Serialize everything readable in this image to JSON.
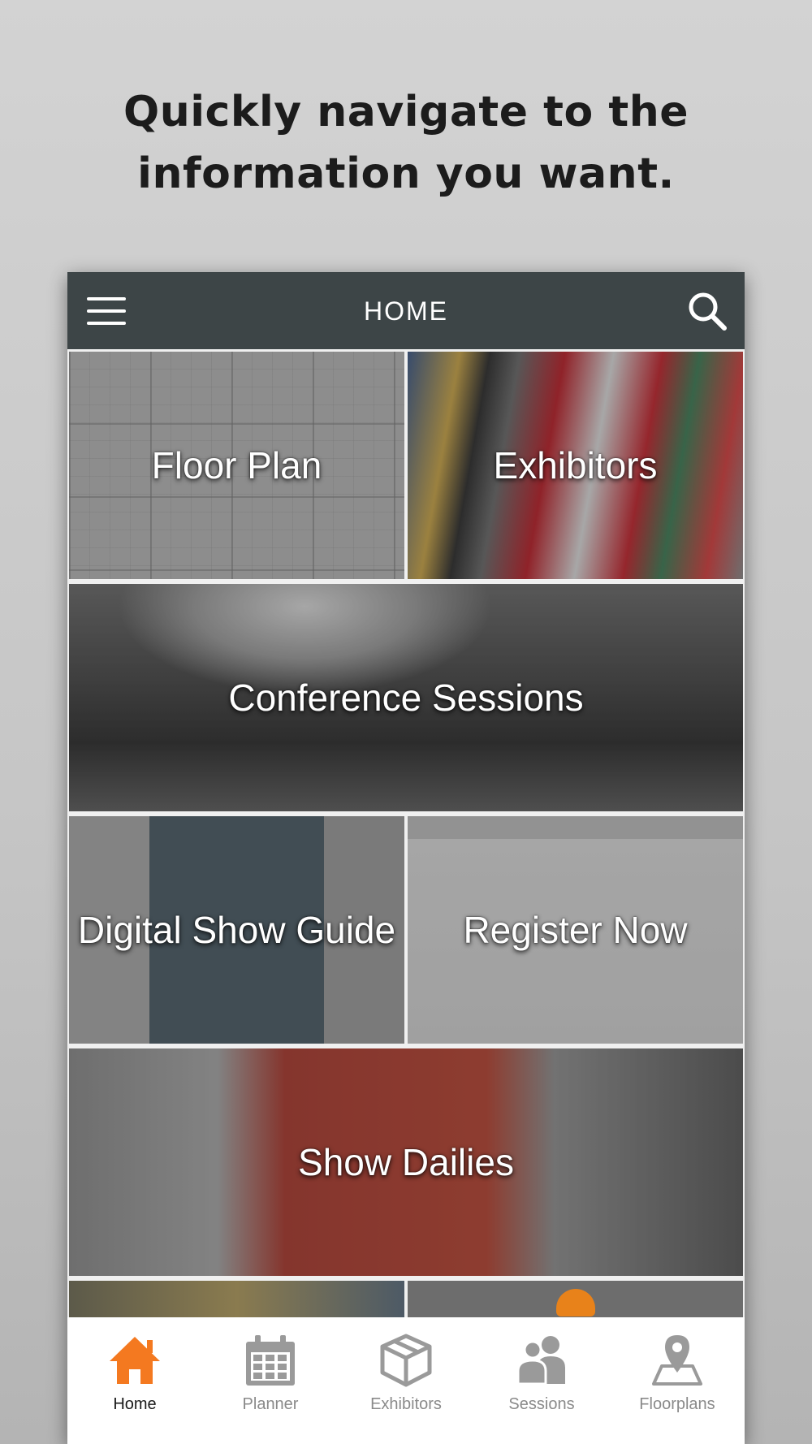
{
  "headline": {
    "line1": "Quickly navigate to the",
    "line2": "information you want."
  },
  "appbar": {
    "title": "HOME",
    "menu_icon": "hamburger-menu-icon",
    "search_icon": "search-icon"
  },
  "tiles": [
    {
      "label": "Floor Plan"
    },
    {
      "label": "Exhibitors"
    },
    {
      "label": "Conference Sessions"
    },
    {
      "label": "Digital Show Guide"
    },
    {
      "label": "Register Now"
    },
    {
      "label": "Show Dailies"
    }
  ],
  "tabbar": {
    "active_color": "#f47920",
    "inactive_color": "#9a9a9a",
    "items": [
      {
        "label": "Home",
        "icon": "home-icon",
        "active": true
      },
      {
        "label": "Planner",
        "icon": "calendar-icon",
        "active": false
      },
      {
        "label": "Exhibitors",
        "icon": "box-icon",
        "active": false
      },
      {
        "label": "Sessions",
        "icon": "people-icon",
        "active": false
      },
      {
        "label": "Floorplans",
        "icon": "map-pin-icon",
        "active": false
      }
    ]
  }
}
